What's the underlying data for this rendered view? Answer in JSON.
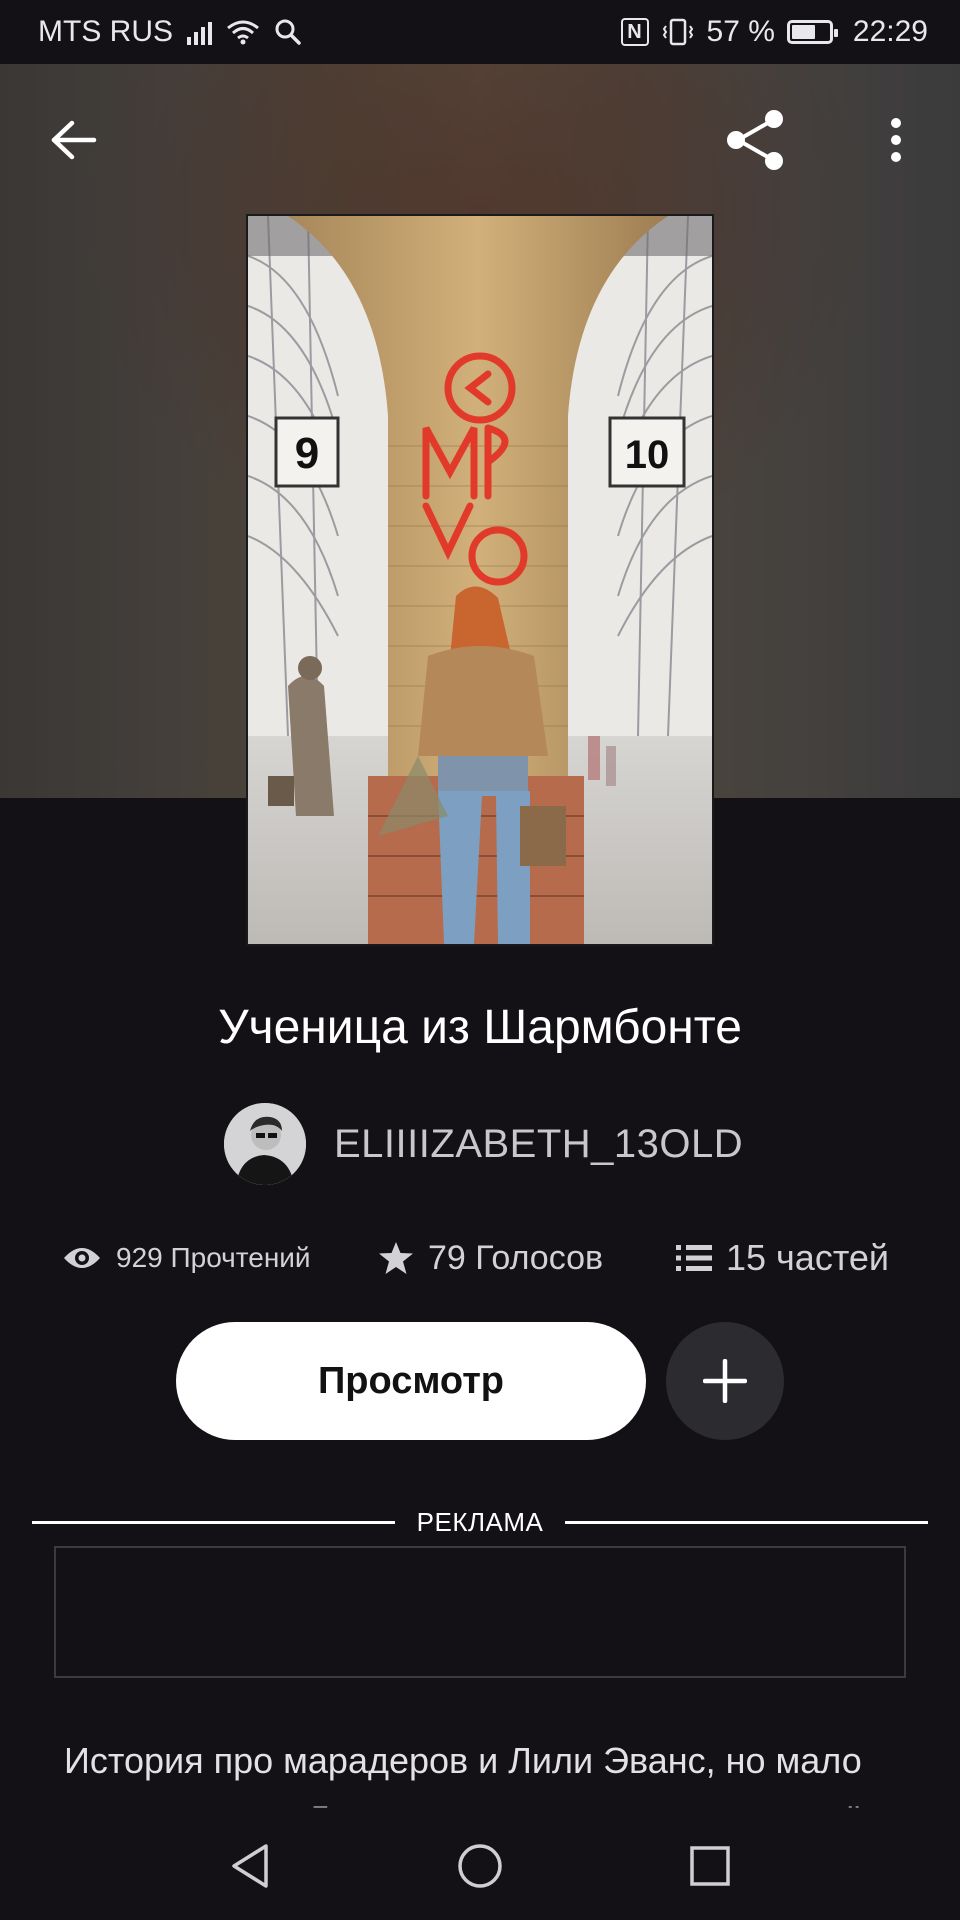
{
  "status_bar": {
    "carrier": "MTS RUS",
    "nfc_label": "N",
    "battery_percent": "57 %",
    "battery_level": 0.57,
    "time": "22:29"
  },
  "story": {
    "title": "Ученица из Шармбонте",
    "author": "ELIIIIZABETH_13OLD",
    "reads": "929 Прочтений",
    "votes": "79 Голосов",
    "parts": "15 частей",
    "description": "История про марадеров и Лили Эванс, но мало кто знал что у Лили есть двоюродная сестра её"
  },
  "cover": {
    "left_sign": "9",
    "right_sign": "10"
  },
  "actions": {
    "read_label": "Просмотр"
  },
  "ad": {
    "label": "РЕКЛАМА"
  },
  "icons": {
    "back": "arrow-left-icon",
    "share": "share-icon",
    "more": "more-vertical-icon",
    "reads": "eye-icon",
    "votes": "star-icon",
    "parts": "list-icon",
    "add": "plus-icon"
  },
  "colors": {
    "background": "#131116",
    "primary_button": "#ffffff",
    "secondary_button": "#2c2b30",
    "logo_red": "#e23a2a"
  }
}
